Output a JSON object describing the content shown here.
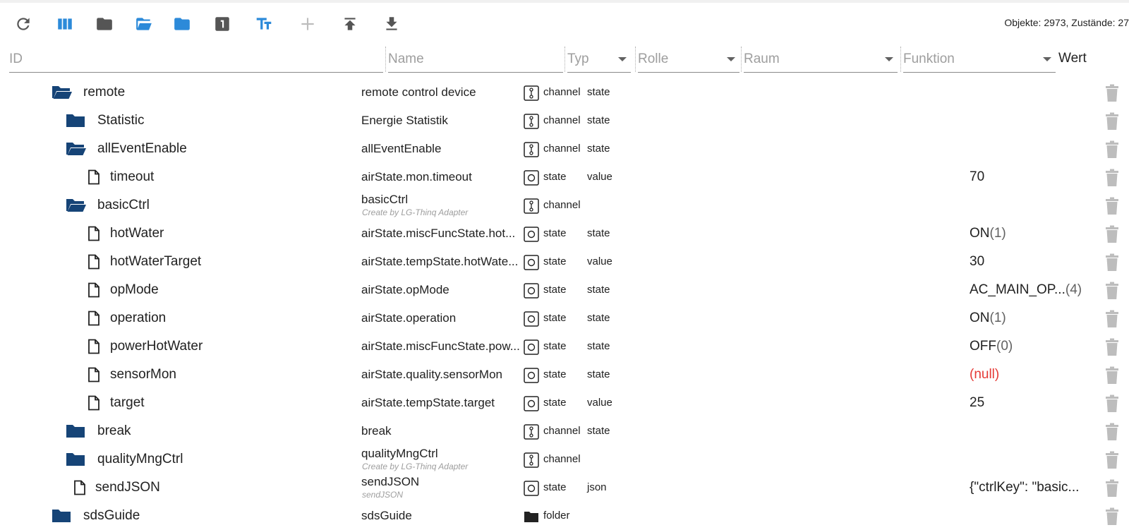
{
  "stats": "Objekte: 2973, Zustände: 27",
  "filters": {
    "id": "ID",
    "name": "Name",
    "typ": "Typ",
    "rolle": "Rolle",
    "raum": "Raum",
    "funktion": "Funktion",
    "wert": "Wert"
  },
  "rows": [
    {
      "id": "remote",
      "name": "remote control device",
      "sub": "",
      "type": "channel",
      "role": "state",
      "value": "",
      "ack": ""
    },
    {
      "id": "Statistic",
      "name": "Energie Statistik",
      "sub": "",
      "type": "channel",
      "role": "state",
      "value": "",
      "ack": ""
    },
    {
      "id": "allEventEnable",
      "name": "allEventEnable",
      "sub": "",
      "type": "channel",
      "role": "state",
      "value": "",
      "ack": ""
    },
    {
      "id": "timeout",
      "name": "airState.mon.timeout",
      "sub": "",
      "type": "state",
      "role": "value",
      "value": "70",
      "ack": ""
    },
    {
      "id": "basicCtrl",
      "name": "basicCtrl",
      "sub": "Create by LG-Thinq Adapter",
      "type": "channel",
      "role": "",
      "value": "",
      "ack": ""
    },
    {
      "id": "hotWater",
      "name": "airState.miscFuncState.hot...",
      "sub": "",
      "type": "state",
      "role": "state",
      "value": "ON",
      "ack": "(1)"
    },
    {
      "id": "hotWaterTarget",
      "name": "airState.tempState.hotWate...",
      "sub": "",
      "type": "state",
      "role": "value",
      "value": "30",
      "ack": ""
    },
    {
      "id": "opMode",
      "name": "airState.opMode",
      "sub": "",
      "type": "state",
      "role": "state",
      "value": "AC_MAIN_OP...",
      "ack": "(4)"
    },
    {
      "id": "operation",
      "name": "airState.operation",
      "sub": "",
      "type": "state",
      "role": "state",
      "value": "ON",
      "ack": "(1)"
    },
    {
      "id": "powerHotWater",
      "name": "airState.miscFuncState.pow...",
      "sub": "",
      "type": "state",
      "role": "state",
      "value": "OFF",
      "ack": "(0)"
    },
    {
      "id": "sensorMon",
      "name": "airState.quality.sensorMon",
      "sub": "",
      "type": "state",
      "role": "state",
      "value": "(null)",
      "ack": ""
    },
    {
      "id": "target",
      "name": "airState.tempState.target",
      "sub": "",
      "type": "state",
      "role": "value",
      "value": "25",
      "ack": ""
    },
    {
      "id": "break",
      "name": "break",
      "sub": "",
      "type": "channel",
      "role": "state",
      "value": "",
      "ack": ""
    },
    {
      "id": "qualityMngCtrl",
      "name": "qualityMngCtrl",
      "sub": "Create by LG-Thinq Adapter",
      "type": "channel",
      "role": "",
      "value": "",
      "ack": ""
    },
    {
      "id": "sendJSON",
      "name": "sendJSON",
      "sub": "sendJSON",
      "type": "state",
      "role": "json",
      "value": "{\"ctrlKey\": \"basic...",
      "ack": ""
    },
    {
      "id": "sdsGuide",
      "name": "sdsGuide",
      "sub": "",
      "type": "folder",
      "role": "",
      "value": "",
      "ack": ""
    }
  ],
  "colors": {
    "folder_blue": "#164477",
    "toolbar_blue": "#2c8ad9",
    "null_red": "#e53935",
    "trash_grey": "#bdbdbd"
  }
}
